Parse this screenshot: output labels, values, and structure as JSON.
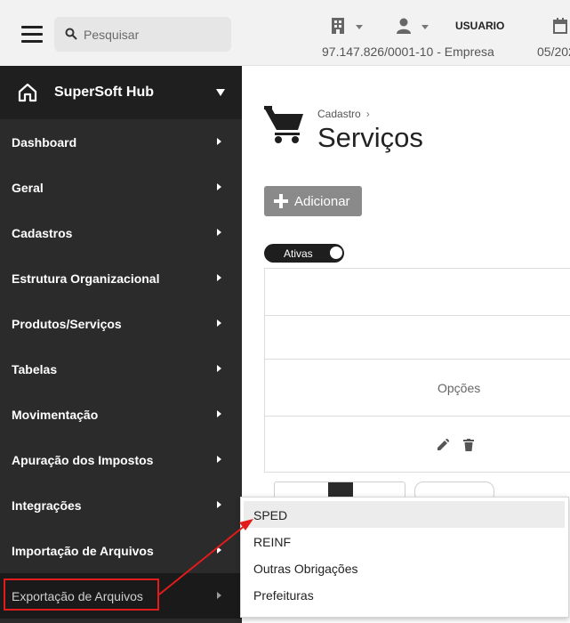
{
  "search": {
    "placeholder": "Pesquisar"
  },
  "header": {
    "user": "USUARIO",
    "company": "97.147.826/0001-10 - Empresa",
    "date": "05/202"
  },
  "sidebar": {
    "brand": "SuperSoft Hub",
    "items": [
      {
        "label": "Dashboard"
      },
      {
        "label": "Geral"
      },
      {
        "label": "Cadastros"
      },
      {
        "label": "Estrutura Organizacional"
      },
      {
        "label": "Produtos/Serviços"
      },
      {
        "label": "Tabelas"
      },
      {
        "label": "Movimentação"
      },
      {
        "label": "Apuração dos Impostos"
      },
      {
        "label": "Integrações"
      },
      {
        "label": "Importação de Arquivos"
      },
      {
        "label": "Exportação de Arquivos"
      }
    ]
  },
  "main": {
    "breadcrumb": "Cadastro",
    "breadcrumb_sep": "›",
    "title": "Serviços",
    "add_button": "Adicionar",
    "toggle_label": "Ativas",
    "table": {
      "options_header": "Opções"
    }
  },
  "dropdown": {
    "items": [
      {
        "label": "SPED"
      },
      {
        "label": "REINF"
      },
      {
        "label": "Outras Obrigações"
      },
      {
        "label": "Prefeituras"
      }
    ]
  },
  "colors": {
    "sidebar_bg": "#2b2b2b",
    "annotation": "#e21b1b",
    "button_bg": "#8a8a8a"
  }
}
